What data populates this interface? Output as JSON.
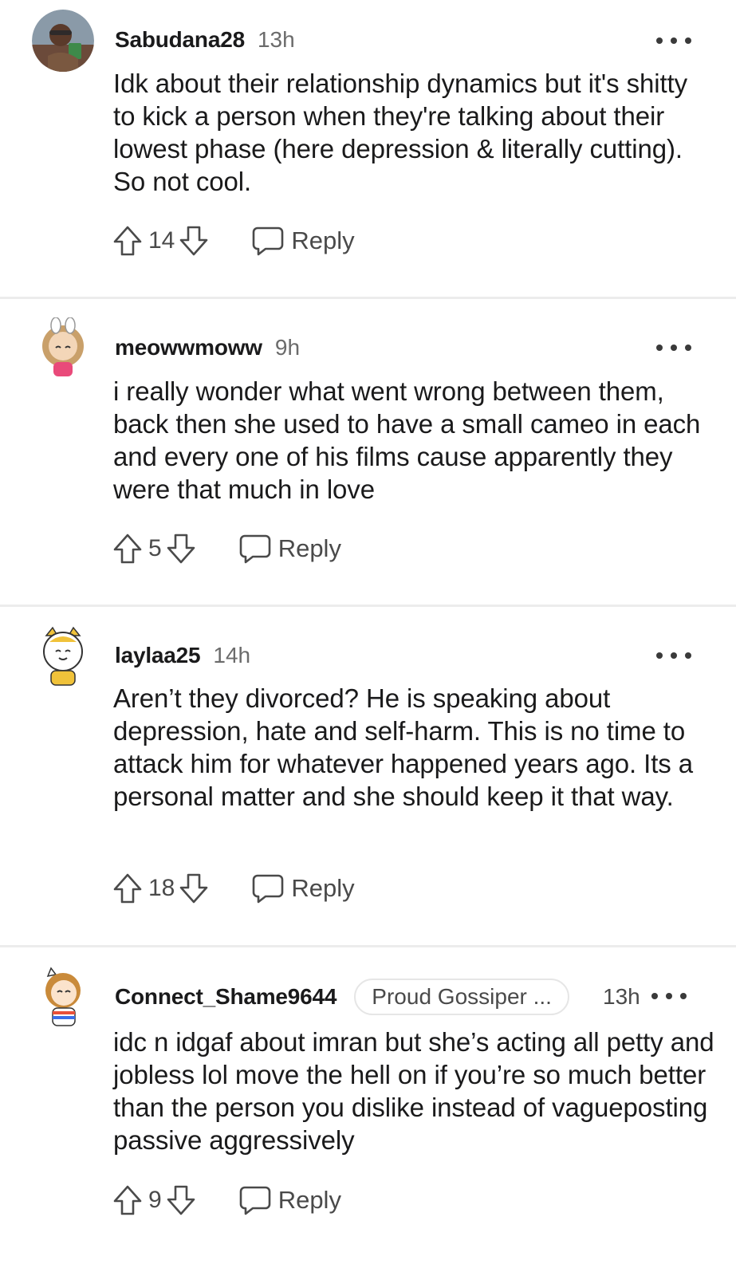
{
  "comments": [
    {
      "username": "Sabudana28",
      "time": "13h",
      "flair": "",
      "avatar": "avatar-image",
      "body": "Idk about their relationship dynamics but it's shitty to kick a person when they're talking about their lowest phase (here depression & literally cutting). So not cool.",
      "score": "14",
      "reply_label": "Reply"
    },
    {
      "username": "meowwmoww",
      "time": "9h",
      "flair": "",
      "avatar": "avatar-image",
      "body": "i really wonder what went wrong between them, back then she used to have a small cameo in each and every one of his films cause apparently they were that much in love",
      "score": "5",
      "reply_label": "Reply"
    },
    {
      "username": "laylaa25",
      "time": "14h",
      "flair": "",
      "avatar": "avatar-image",
      "body": "Aren’t they divorced? He is speaking about depression, hate and self-harm. This is no time to attack him for whatever happened years ago. Its a personal matter and she should keep it that way.",
      "score": "18",
      "reply_label": "Reply"
    },
    {
      "username": "Connect_Shame9644",
      "time": "13h",
      "flair": "Proud Gossiper ...",
      "avatar": "avatar-image",
      "body": "idc n idgaf about imran but she’s acting all petty and jobless lol move the hell on if you’re so much better than the person you dislike instead of vagueposting passive aggressively",
      "score": "9",
      "reply_label": "Reply"
    }
  ],
  "icons": {
    "upvote": "arrow-up-outline-icon",
    "downvote": "arrow-down-outline-icon",
    "reply": "speech-bubble-icon",
    "more": "ellipsis-icon"
  },
  "colors": {
    "text_primary": "#1a1a1b",
    "text_secondary": "#4a4a4a",
    "divider": "#ececec"
  }
}
